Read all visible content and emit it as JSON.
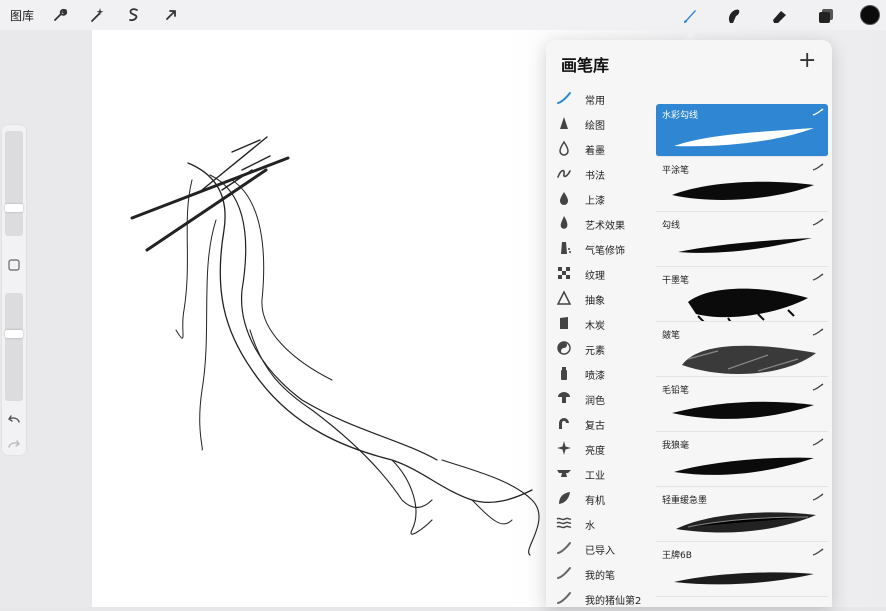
{
  "topbar": {
    "gallery_label": "图库",
    "left_tools": [
      "wrench-icon",
      "magic-wand-icon",
      "selection-icon",
      "transform-arrow-icon"
    ],
    "right_tools": [
      "brush-icon",
      "smudge-icon",
      "eraser-icon",
      "layers-icon"
    ],
    "active_tool": "brush-icon",
    "accent_color": "#2f86d3",
    "current_color": "#0b0b0b"
  },
  "side_tools": {
    "size_slider_level": 0.25,
    "opacity_slider_level": 0.38,
    "modify_button": "square-icon",
    "undo": "undo-icon",
    "redo": "redo-icon"
  },
  "brush_library": {
    "title": "画笔库",
    "add_label": "+",
    "categories": [
      {
        "label": "常用",
        "icon": "stroke-icon"
      },
      {
        "label": "绘图",
        "icon": "pencil-tip-icon"
      },
      {
        "label": "着墨",
        "icon": "ink-drop-icon"
      },
      {
        "label": "书法",
        "icon": "calligraphy-icon"
      },
      {
        "label": "上漆",
        "icon": "paint-drop-icon"
      },
      {
        "label": "艺术效果",
        "icon": "flame-drop-icon"
      },
      {
        "label": "气笔修饰",
        "icon": "airbrush-icon"
      },
      {
        "label": "纹理",
        "icon": "checker-icon"
      },
      {
        "label": "抽象",
        "icon": "triangle-icon"
      },
      {
        "label": "木炭",
        "icon": "charcoal-icon"
      },
      {
        "label": "元素",
        "icon": "yin-yang-icon"
      },
      {
        "label": "喷漆",
        "icon": "spray-can-icon"
      },
      {
        "label": "润色",
        "icon": "mushroom-icon"
      },
      {
        "label": "复古",
        "icon": "retro-arch-icon"
      },
      {
        "label": "亮度",
        "icon": "sparkle-icon"
      },
      {
        "label": "工业",
        "icon": "anvil-icon"
      },
      {
        "label": "有机",
        "icon": "leaf-icon"
      },
      {
        "label": "水",
        "icon": "waves-icon"
      },
      {
        "label": "已导入",
        "icon": "stroke-icon"
      },
      {
        "label": "我的笔",
        "icon": "stroke-icon"
      },
      {
        "label": "我的猪仙第2",
        "icon": "stroke-icon"
      }
    ],
    "selected_category": "常用",
    "brushes": [
      {
        "name": "水彩勾线",
        "stroke": "watercolor-line",
        "selected": true
      },
      {
        "name": "平涂笔",
        "stroke": "flat-fill"
      },
      {
        "name": "勾线",
        "stroke": "line"
      },
      {
        "name": "干墨笔",
        "stroke": "dry-ink"
      },
      {
        "name": "皴笔",
        "stroke": "texture"
      },
      {
        "name": "毛铅笔",
        "stroke": "rough-pencil"
      },
      {
        "name": "我狼毫",
        "stroke": "wolf-hair"
      },
      {
        "name": "轻重缓急墨",
        "stroke": "variable-ink"
      },
      {
        "name": "王牌6B",
        "stroke": "pencil-6b"
      }
    ]
  }
}
